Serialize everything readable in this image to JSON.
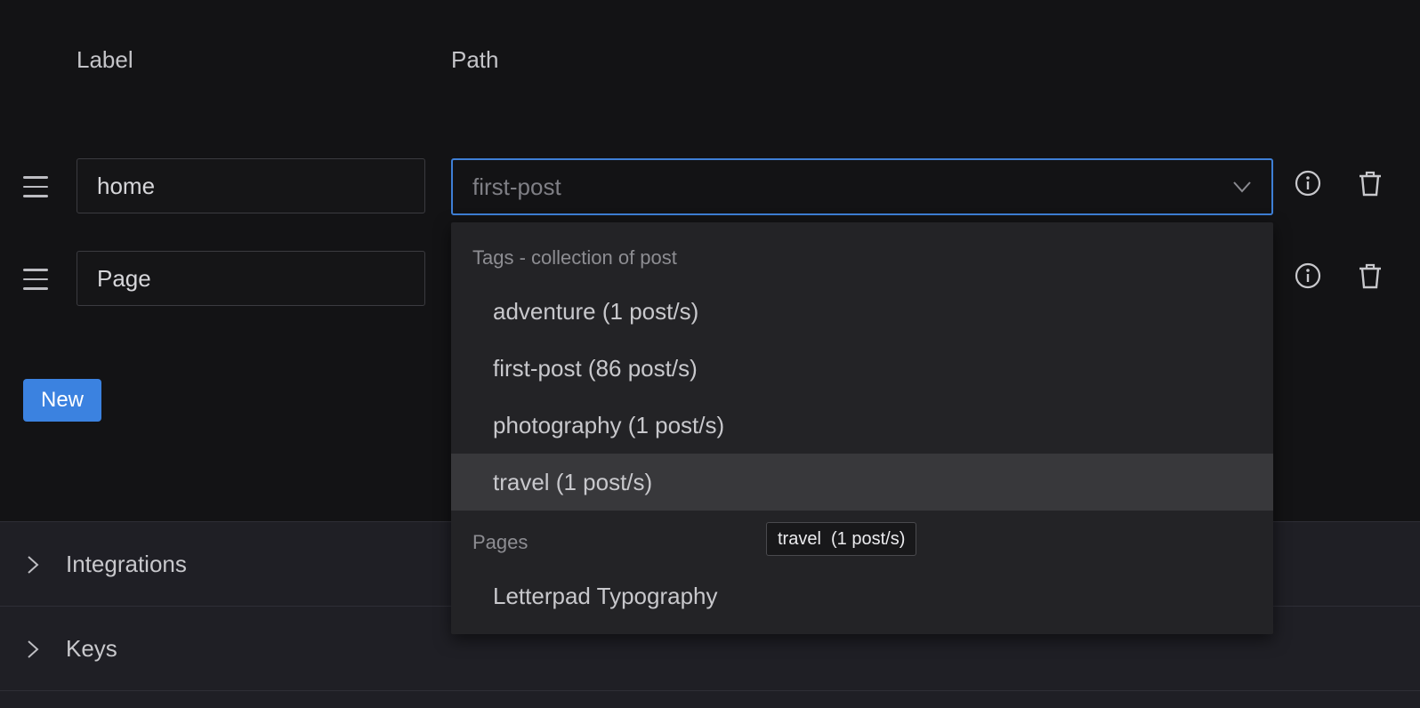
{
  "columns": {
    "label": "Label",
    "path": "Path"
  },
  "rows": [
    {
      "label": "home",
      "path": "first-post"
    },
    {
      "label": "Page"
    }
  ],
  "icons": {
    "drag": "hamburger-drag-icon",
    "info": "info-circle-icon",
    "delete": "trash-icon",
    "chevron": "chevron-down-icon",
    "expand": "chevron-right-icon"
  },
  "new_button": "New",
  "dropdown": {
    "groups": [
      {
        "label": "Tags - collection of post",
        "options": [
          "adventure (1 post/s)",
          "first-post (86 post/s)",
          "photography (1 post/s)",
          "travel (1 post/s)"
        ]
      },
      {
        "label": "Pages",
        "options": [
          "Letterpad Typography"
        ]
      }
    ],
    "active_option": "travel (1 post/s)"
  },
  "tooltip": "travel  (1 post/s)",
  "sections": [
    {
      "title": "Integrations"
    },
    {
      "title": "Keys"
    }
  ],
  "colors": {
    "accent": "#3b82e0",
    "focus_border": "#3e7fd6",
    "background": "#131315",
    "dropdown_bg": "#232326"
  }
}
